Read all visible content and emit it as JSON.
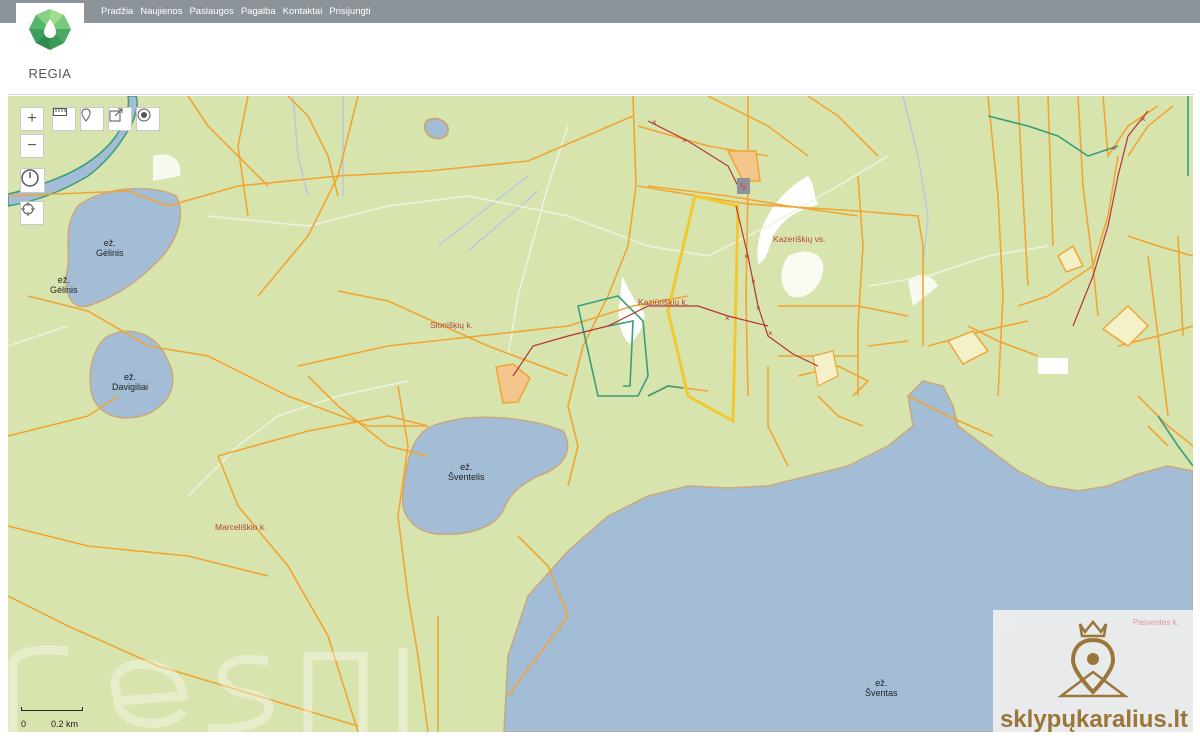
{
  "brand": {
    "name": "REGIA"
  },
  "nav": [
    "Pradžia",
    "Naujienos",
    "Paslaugos",
    "Pagalba",
    "Kontaktai",
    "Prisijungti"
  ],
  "controls": {
    "zoom_in": "+",
    "zoom_out": "−"
  },
  "labels": {
    "lake_gelinis": "ež.\nGėlinis",
    "gelinis_village": "ež.\nGėlinis",
    "lake_davigiliai": "ež.\nDavigiliai",
    "lake_sventelis": "ež.\nŠventelis",
    "lake_sventas": "ež.\nŠventas",
    "sloniskiu": "Slonišķių k.",
    "kaziuriskiu": "Kaziūriškių k.",
    "kazeriskiu": "Kazeriškių vs.",
    "marceliskio": "Marceliškio k.",
    "pasventes": "Pasventės k."
  },
  "scale": {
    "zero": "0",
    "distance": "0.2 km"
  },
  "watermark": {
    "site": "sklypųkaralius.lt"
  },
  "colors": {
    "land": "#d8e4ae",
    "water": "#a4bdd6",
    "boundary": "#f0a532",
    "highlight": "#f2c832",
    "forest_edge": "#3a9c7a",
    "power_line": "#b5323a"
  }
}
